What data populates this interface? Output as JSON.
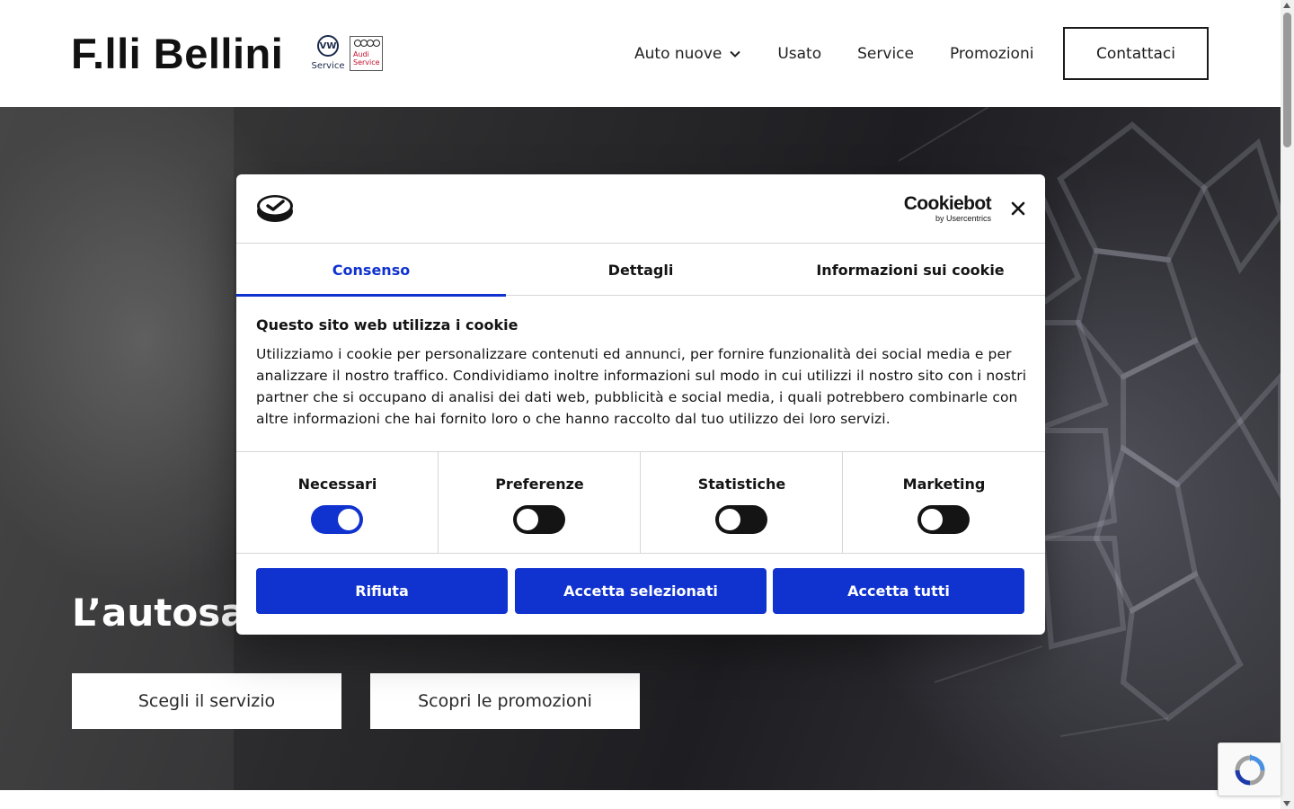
{
  "header": {
    "logo": "F.lli Bellini",
    "vw_badge": {
      "mark": "VW",
      "label": "Service"
    },
    "audi_badge": {
      "label_line1": "Audi",
      "label_line2": "Service"
    },
    "nav": [
      {
        "label": "Auto nuove",
        "has_dropdown": true
      },
      {
        "label": "Usato"
      },
      {
        "label": "Service"
      },
      {
        "label": "Promozioni"
      }
    ],
    "contact_button": "Contattaci"
  },
  "hero": {
    "title_visible": "L’autosa",
    "buttons": [
      "Scegli il servizio",
      "Scopri le promozioni"
    ]
  },
  "cookie_dialog": {
    "brand": {
      "name": "Cookiebot",
      "by": "by Usercentrics"
    },
    "icons": {
      "logo": "cookiebot-logo-icon",
      "close": "close-icon"
    },
    "tabs": [
      {
        "label": "Consenso",
        "active": true
      },
      {
        "label": "Dettagli",
        "active": false
      },
      {
        "label": "Informazioni sui cookie",
        "active": false
      }
    ],
    "heading": "Questo sito web utilizza i cookie",
    "body": "Utilizziamo i cookie per personalizzare contenuti ed annunci, per fornire funzionalità dei social media e per analizzare il nostro traffico. Condividiamo inoltre informazioni sul modo in cui utilizzi il nostro sito con i nostri partner che si occupano di analisi dei dati web, pubblicità e social media, i quali potrebbero combinarle con altre informazioni che hai fornito loro o che hanno raccolto dal tuo utilizzo dei loro servizi.",
    "toggles": [
      {
        "label": "Necessari",
        "on": true
      },
      {
        "label": "Preferenze",
        "on": false
      },
      {
        "label": "Statistiche",
        "on": false
      },
      {
        "label": "Marketing",
        "on": false
      }
    ],
    "actions": {
      "reject": "Rifiuta",
      "accept_selected": "Accetta selezionati",
      "accept_all": "Accetta tutti"
    },
    "colors": {
      "accent": "#1032cf",
      "text": "#141414"
    }
  },
  "recaptcha": {
    "icon": "recaptcha-icon"
  }
}
